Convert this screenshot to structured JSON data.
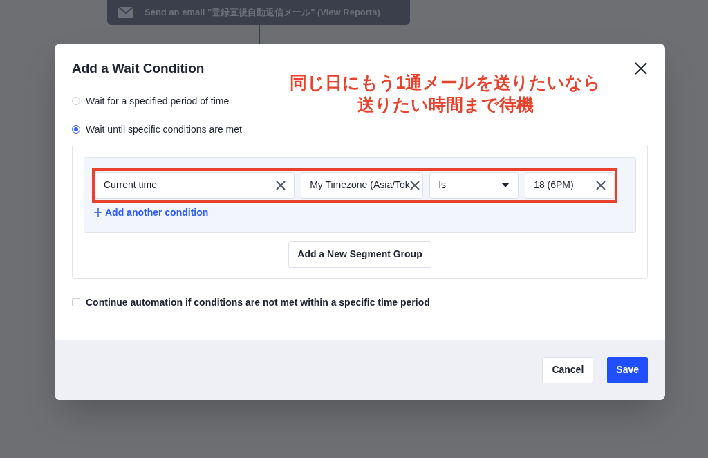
{
  "background_step": {
    "text": "Send an email \"登録直後自動返信メール\" (View Reports)"
  },
  "dialog": {
    "title": "Add a Wait Condition",
    "options": [
      {
        "label": "Wait for a specified period of time",
        "selected": false
      },
      {
        "label": "Wait until specific conditions are met",
        "selected": true
      }
    ],
    "conditions": [
      {
        "kind": "field",
        "value": "Current time"
      },
      {
        "kind": "field",
        "value": "My Timezone (Asia/Tok"
      },
      {
        "kind": "select",
        "value": "Is"
      },
      {
        "kind": "field",
        "value": "18 (6PM)"
      }
    ],
    "add_condition": "Add another condition",
    "add_group": "Add a New Segment Group",
    "continue_option": {
      "label": "Continue automation if conditions are not met within a specific time period",
      "checked": false
    },
    "buttons": [
      {
        "label": "Cancel",
        "kind": "secondary"
      },
      {
        "label": "Save",
        "kind": "primary"
      }
    ]
  },
  "annotation": {
    "lines": [
      "同じ日にもう1通メールを送りたいなら",
      "送りたい時間まで待機"
    ]
  }
}
